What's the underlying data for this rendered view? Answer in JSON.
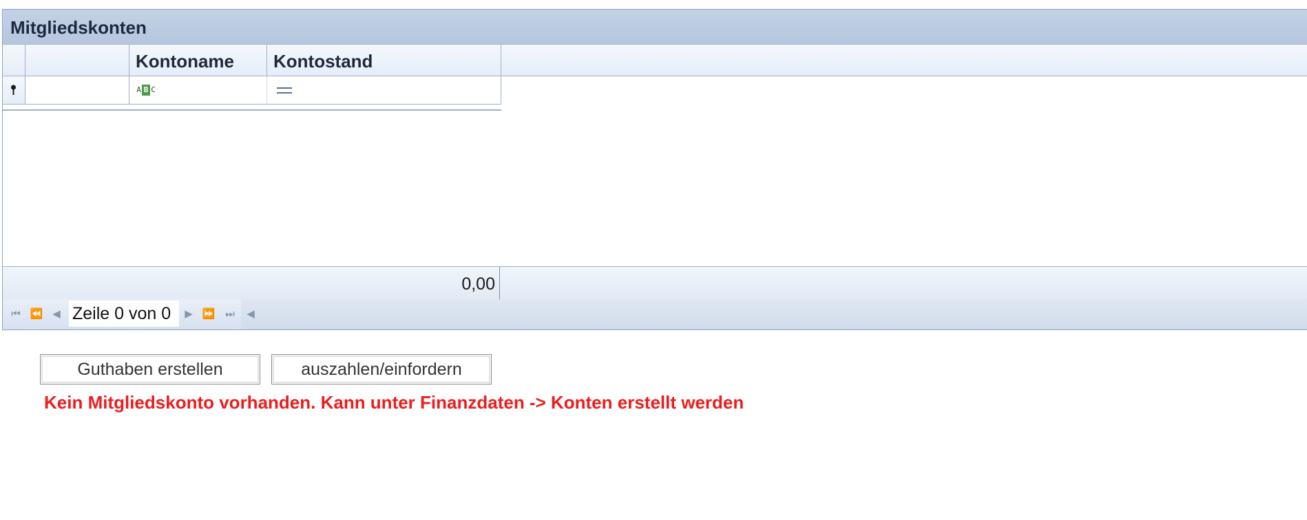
{
  "panel": {
    "caption": "Mitgliedskonten"
  },
  "grid": {
    "columns": [
      "",
      "Kontoname",
      "Kontostand"
    ],
    "new_row_icons": {
      "indicator": "pin-icon",
      "kontoname": "text-filter-abc-icon",
      "kontostand": "equals-filter-icon"
    },
    "abc_glyph": {
      "a": "A",
      "b": "B",
      "c": "C"
    },
    "footer_sum": "0,00"
  },
  "navigator": {
    "status": "Zeile 0 von 0",
    "buttons": [
      "first-record",
      "previous-page",
      "previous-record",
      "next-record",
      "next-page",
      "last-record"
    ]
  },
  "actions": {
    "guthaben_label": "Guthaben erstellen",
    "auszahlen_label": "auszahlen/einfordern"
  },
  "message": {
    "text": "Kein Mitgliedskonto vorhanden. Kann unter Finanzdaten -> Konten erstellt werden",
    "color": "#ee1c1c"
  },
  "colors": {
    "caption_bg": "#b5c6de",
    "header_bg": "#e5edf8",
    "border": "#9cb0cf"
  }
}
